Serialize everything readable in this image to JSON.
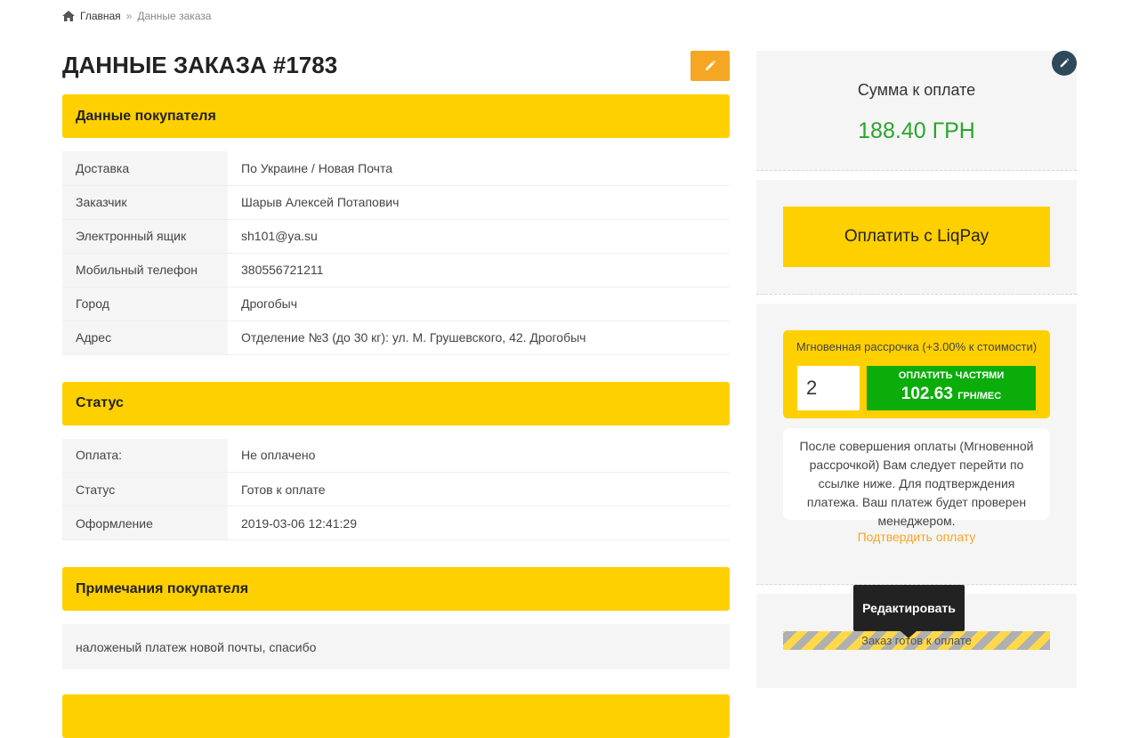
{
  "breadcrumb": {
    "home_label": "Главная",
    "separator": "»",
    "current": "Данные заказа"
  },
  "page": {
    "title": "ДАННЫЕ ЗАКАЗА #1783",
    "edit_icon": "pencil-icon"
  },
  "buyer": {
    "heading": "Данные покупателя",
    "rows": [
      {
        "key": "Доставка",
        "value": "По Украине / Новая Почта"
      },
      {
        "key": "Заказчик",
        "value": "Шарыв Алексей Потапович"
      },
      {
        "key": "Электронный ящик",
        "value": "sh101@ya.su"
      },
      {
        "key": "Мобильный телефон",
        "value": "380556721211"
      },
      {
        "key": "Город",
        "value": "Дрогобыч"
      },
      {
        "key": "Адрес",
        "value": "Отделение №3 (до 30 кг): ул. М. Грушевского, 42. Дрогобыч"
      }
    ]
  },
  "status": {
    "heading": "Статус",
    "rows": [
      {
        "key": "Оплата:",
        "value": "Не оплачено"
      },
      {
        "key": "Статус",
        "value": "Готов к оплате"
      },
      {
        "key": "Оформление",
        "value": "2019-03-06 12:41:29"
      }
    ]
  },
  "notes": {
    "heading": "Примечания покупателя",
    "text": "наложеный платеж новой почты, спасибо"
  },
  "sidebar": {
    "sum_label": "Сумма к оплате",
    "sum_value": "188.40 ГРН",
    "liqpay_label": "Оплатить с LiqPay",
    "installment": {
      "title": "Мгновенная рассрочка (+3.00% к стоимости)",
      "months_value": "2",
      "button_label": "ОПЛАТИТЬ ЧАСТЯМИ",
      "amount": "102.63",
      "unit": "ГРН/МЕС"
    },
    "info_text": "После совершения оплаты (Мгновенной рассрочкой) Вам следует перейти по ссылке ниже. Для подтверждения платежа. Ваш платеж будет проверен менеджером.",
    "confirm_link": "Подтвердить оплату",
    "status_bar": "Заказ готов к оплате",
    "tooltip": "Редактировать"
  },
  "colors": {
    "accent_yellow": "#ffd000",
    "edit_orange": "#f5a623",
    "sum_green": "#2aa52a",
    "pay_green": "#0aad0a"
  }
}
